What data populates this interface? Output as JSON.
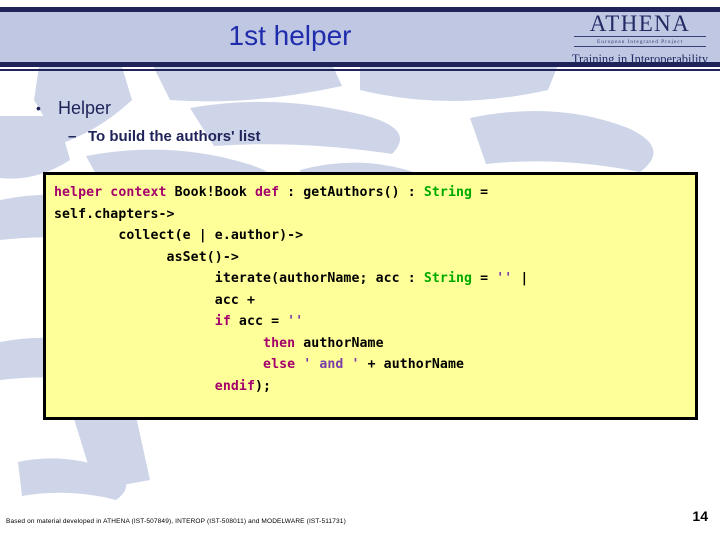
{
  "header": {
    "title": "1st helper",
    "logo": {
      "name": "ATHENA",
      "subtitle": "European Integrated Project",
      "tagline": "Training in Interoperability"
    },
    "band_color": "#bfc7e3",
    "rule_color": "#1f2359",
    "title_color": "#1f2dad"
  },
  "bullets": {
    "level1": "Helper",
    "level1_marker": "•",
    "level2": "To build the authors' list",
    "level2_marker": "–",
    "text_color": "#1f2359"
  },
  "code_box": {
    "background": "#ffff99",
    "border_color": "#000000",
    "colors": {
      "keyword": "#a3006b",
      "type": "#00aa00",
      "string": "#7a3ca8",
      "plain": "#000000"
    },
    "lines": [
      [
        {
          "t": "helper context ",
          "c": "kw"
        },
        {
          "t": "Book!Book ",
          "c": "pln"
        },
        {
          "t": "def",
          "c": "kw"
        },
        {
          "t": " : getAuthors() : ",
          "c": "pln"
        },
        {
          "t": "String",
          "c": "typ"
        },
        {
          "t": " =",
          "c": "pln"
        }
      ],
      [
        {
          "t": "self.chapters->",
          "c": "pln"
        }
      ],
      [
        {
          "t": "        collect(e | e.author)->",
          "c": "pln"
        }
      ],
      [
        {
          "t": "              asSet()->",
          "c": "pln"
        }
      ],
      [
        {
          "t": "                    iterate(authorName; acc : ",
          "c": "pln"
        },
        {
          "t": "String",
          "c": "typ"
        },
        {
          "t": " = ",
          "c": "pln"
        },
        {
          "t": "''",
          "c": "str"
        },
        {
          "t": " |",
          "c": "pln"
        }
      ],
      [
        {
          "t": "                    acc +",
          "c": "pln"
        }
      ],
      [
        {
          "t": "                    ",
          "c": "pln"
        },
        {
          "t": "if",
          "c": "kw"
        },
        {
          "t": " acc = ",
          "c": "pln"
        },
        {
          "t": "''",
          "c": "str"
        }
      ],
      [
        {
          "t": "                          ",
          "c": "pln"
        },
        {
          "t": "then",
          "c": "kw"
        },
        {
          "t": " authorName",
          "c": "pln"
        }
      ],
      [
        {
          "t": "                          ",
          "c": "pln"
        },
        {
          "t": "else",
          "c": "kw"
        },
        {
          "t": " ",
          "c": "pln"
        },
        {
          "t": "' and '",
          "c": "str"
        },
        {
          "t": " + authorName",
          "c": "pln"
        }
      ],
      [
        {
          "t": "                    ",
          "c": "pln"
        },
        {
          "t": "endif",
          "c": "kw"
        },
        {
          "t": ");",
          "c": "pln"
        }
      ]
    ]
  },
  "footer": {
    "note": "Based on material developed in ATHENA (IST-507849), INTEROP (IST-508011) and  MODELWARE (IST-511731)",
    "page_number": "14"
  }
}
